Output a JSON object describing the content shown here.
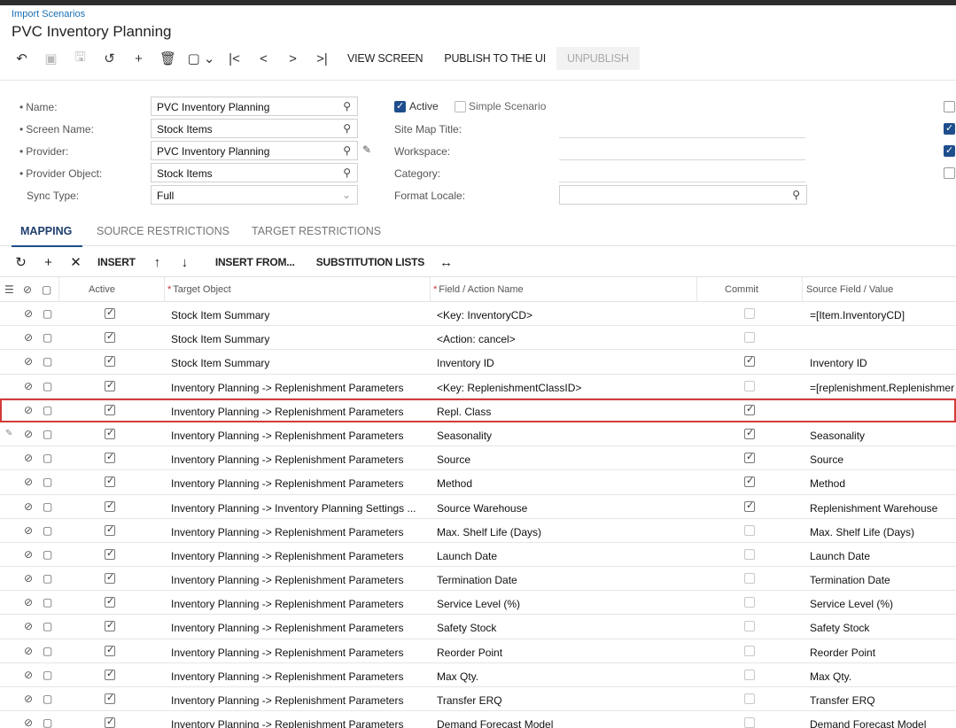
{
  "breadcrumb": "Import Scenarios",
  "title": "PVC Inventory Planning",
  "toolbar": {
    "icons": [
      "back-icon",
      "save-close-icon",
      "save-icon",
      "undo-icon",
      "add-icon",
      "delete-icon",
      "copy-paste-icon",
      "first-icon",
      "prev-icon",
      "next-icon",
      "last-icon"
    ],
    "view_screen": "VIEW SCREEN",
    "publish": "PUBLISH TO THE UI",
    "unpublish": "UNPUBLISH"
  },
  "form": {
    "name_label": "Name:",
    "name_value": "PVC Inventory Planning",
    "screen_name_label": "Screen Name:",
    "screen_name_value": "Stock Items",
    "provider_label": "Provider:",
    "provider_value": "PVC Inventory Planning",
    "provider_object_label": "Provider Object:",
    "provider_object_value": "Stock Items",
    "sync_type_label": "Sync Type:",
    "sync_type_value": "Full",
    "active_label": "Active",
    "active_checked": true,
    "simple_scenario_label": "Simple Scenario",
    "simple_scenario_checked": false,
    "site_map_title_label": "Site Map Title:",
    "workspace_label": "Workspace:",
    "category_label": "Category:",
    "format_locale_label": "Format Locale:",
    "right_checks": [
      false,
      true,
      true,
      false
    ]
  },
  "tabs": [
    "MAPPING",
    "SOURCE RESTRICTIONS",
    "TARGET RESTRICTIONS"
  ],
  "grid_toolbar": {
    "insert": "INSERT",
    "insert_from": "INSERT FROM...",
    "substitution_lists": "SUBSTITUTION LISTS"
  },
  "grid": {
    "columns": {
      "active": "Active",
      "target_object": "Target Object",
      "field_action": "Field / Action Name",
      "commit": "Commit",
      "source_field": "Source Field / Value"
    },
    "rows": [
      {
        "active": true,
        "target": "Stock Item Summary",
        "field": "<Key: InventoryCD>",
        "commit": false,
        "source": "=[Item.InventoryCD]"
      },
      {
        "active": true,
        "target": "Stock Item Summary",
        "field": "<Action: cancel>",
        "commit": false,
        "source": ""
      },
      {
        "active": true,
        "target": "Stock Item Summary",
        "field": "Inventory ID",
        "commit": true,
        "source": "Inventory ID"
      },
      {
        "active": true,
        "target": "Inventory Planning -> Replenishment Parameters",
        "field": "<Key: ReplenishmentClassID>",
        "commit": false,
        "source": "=[replenishment.Replenishmer"
      },
      {
        "active": true,
        "target": "Inventory Planning -> Replenishment Parameters",
        "field": "Repl. Class",
        "commit": true,
        "source": "",
        "selected": true
      },
      {
        "active": true,
        "target": "Inventory Planning -> Replenishment Parameters",
        "field": "Seasonality",
        "commit": true,
        "source": "Seasonality",
        "editing": true
      },
      {
        "active": true,
        "target": "Inventory Planning -> Replenishment Parameters",
        "field": "Source",
        "commit": true,
        "source": "Source"
      },
      {
        "active": true,
        "target": "Inventory Planning -> Replenishment Parameters",
        "field": "Method",
        "commit": true,
        "source": "Method"
      },
      {
        "active": true,
        "target": "Inventory Planning -> Inventory Planning Settings ...",
        "field": "Source Warehouse",
        "commit": true,
        "source": "Replenishment Warehouse"
      },
      {
        "active": true,
        "target": "Inventory Planning -> Replenishment Parameters",
        "field": "Max. Shelf Life (Days)",
        "commit": false,
        "source": "Max. Shelf Life (Days)"
      },
      {
        "active": true,
        "target": "Inventory Planning -> Replenishment Parameters",
        "field": "Launch Date",
        "commit": false,
        "source": "Launch Date"
      },
      {
        "active": true,
        "target": "Inventory Planning -> Replenishment Parameters",
        "field": "Termination Date",
        "commit": false,
        "source": "Termination Date"
      },
      {
        "active": true,
        "target": "Inventory Planning -> Replenishment Parameters",
        "field": "Service Level (%)",
        "commit": false,
        "source": "Service Level (%)"
      },
      {
        "active": true,
        "target": "Inventory Planning -> Replenishment Parameters",
        "field": "Safety Stock",
        "commit": false,
        "source": "Safety Stock"
      },
      {
        "active": true,
        "target": "Inventory Planning -> Replenishment Parameters",
        "field": "Reorder Point",
        "commit": false,
        "source": "Reorder Point"
      },
      {
        "active": true,
        "target": "Inventory Planning -> Replenishment Parameters",
        "field": "Max Qty.",
        "commit": false,
        "source": "Max Qty."
      },
      {
        "active": true,
        "target": "Inventory Planning -> Replenishment Parameters",
        "field": "Transfer ERQ",
        "commit": false,
        "source": "Transfer ERQ"
      },
      {
        "active": true,
        "target": "Inventory Planning -> Replenishment Parameters",
        "field": "Demand Forecast Model",
        "commit": false,
        "source": "Demand Forecast Model"
      }
    ]
  },
  "colors": {
    "accent": "#1e4e8c",
    "link": "#1a6fb3",
    "selection": "#d43a3a"
  }
}
